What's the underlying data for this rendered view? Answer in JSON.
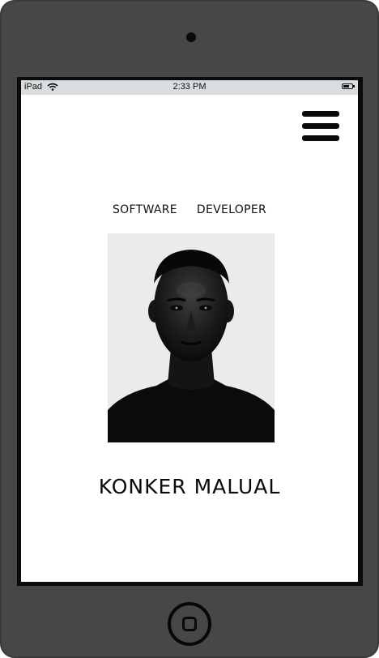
{
  "device": {
    "camera_icon": "camera-dot",
    "home_icon": "home-square-icon"
  },
  "status_bar": {
    "carrier": "iPad",
    "time": "2:33 PM",
    "wifi_icon": "wifi-icon",
    "battery_icon": "battery-icon",
    "battery_level": 0.7
  },
  "header": {
    "menu_icon": "hamburger-menu-icon"
  },
  "profile": {
    "role_words": [
      "SOFTWARE",
      "DEVELOPER"
    ],
    "photo_description_icon": "portrait-photo",
    "name": "KONKER MALUAL"
  },
  "colors": {
    "device_body": "#474747",
    "screen_bezel": "#0b0b0b",
    "status_bar_bg": "#d9dde0",
    "text": "#111111"
  }
}
